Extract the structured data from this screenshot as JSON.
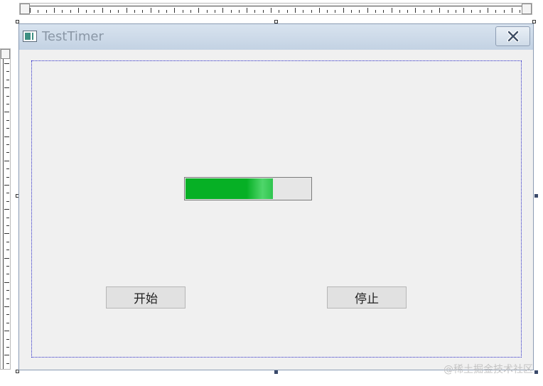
{
  "window": {
    "title": "TestTimer",
    "icon": "window-app-icon",
    "close_icon": "close-icon"
  },
  "progress": {
    "value_percent": 70,
    "color": "#06b025"
  },
  "buttons": {
    "start_label": "开始",
    "stop_label": "停止"
  },
  "watermark": "@稀土掘金技术社区"
}
